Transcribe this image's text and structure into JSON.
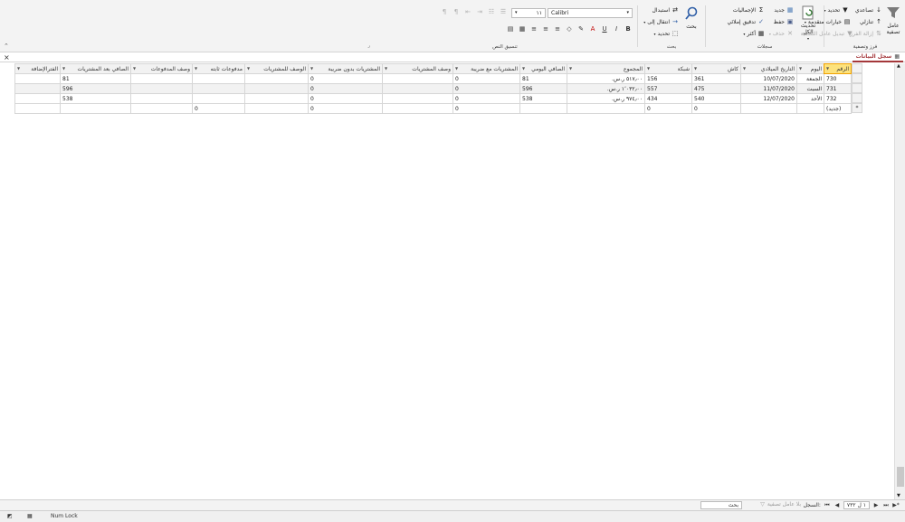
{
  "ribbon": {
    "sort_filter": {
      "group_title": "فرز وتصفية",
      "filter_label": "عامل تصفية",
      "ascending": "تصاعدي",
      "descending": "تنازلي",
      "remove_sort": "إزالة الفرز",
      "selection": "تحديد",
      "advanced": "خيارات متقدمة",
      "toggle_filter": "تبديل عامل التصفية"
    },
    "records": {
      "group_title": "سجلات",
      "refresh_all": "تحديث الكل",
      "new": "جديد",
      "save": "حفظ",
      "delete": "حذف",
      "totals": "الإجماليات",
      "spelling": "تدقيق إملائي",
      "more": "أكثر"
    },
    "find": {
      "group_title": "بحث",
      "find": "بحث",
      "replace": "استبدال",
      "goto": "انتقال إلى",
      "select": "تحديد"
    },
    "text_format": {
      "group_title": "تنسيق النص",
      "font_name": "Calibri",
      "font_size": "١١"
    }
  },
  "document_tab": {
    "title": "سجل البيانات"
  },
  "datasheet": {
    "columns": [
      "الرقم",
      "اليوم",
      "التاريخ الميلادي",
      "كاش",
      "شبكة",
      "المجموع",
      "الصافي اليومي",
      "المشتريات مع ضريبة",
      "وصف المشتريات",
      "المشتريات بدون ضريبة",
      "الوصف للمشتريات",
      "مدفوعات ثابته",
      "وصف المدفوعات",
      "الصافي بعد المشتريات",
      "الفترالإضافة"
    ],
    "rows": [
      [
        "730",
        "الجمعة",
        "10/07/2020",
        "361",
        "156",
        "٥١٧٫٠٠ ر.س.",
        "81",
        "0",
        "",
        "0",
        "",
        "",
        "",
        "81",
        ""
      ],
      [
        "731",
        "السبت",
        "11/07/2020",
        "475",
        "557",
        "١٬٠٣٢٫٠٠ ر.س.",
        "596",
        "0",
        "",
        "0",
        "",
        "",
        "",
        "596",
        ""
      ],
      [
        "732",
        "الأحد",
        "12/07/2020",
        "540",
        "434",
        "٩٧٤٫٠٠ ر.س.",
        "538",
        "0",
        "",
        "0",
        "",
        "",
        "",
        "538",
        ""
      ]
    ],
    "new_row": [
      "(جديد)",
      "",
      "",
      "0",
      "0",
      "",
      "",
      "0",
      "",
      "0",
      "",
      "0",
      "",
      "",
      ""
    ],
    "new_marker": "*"
  },
  "navigation": {
    "record_label": "السجل:",
    "position": "١ ل ٧٣٢",
    "no_filter": "بلا عامل تصفية",
    "search_label": "بحث"
  },
  "status": {
    "num_lock": "Num Lock"
  },
  "colors": {
    "accent": "#a4373a",
    "selected_header": "#fde27c"
  }
}
